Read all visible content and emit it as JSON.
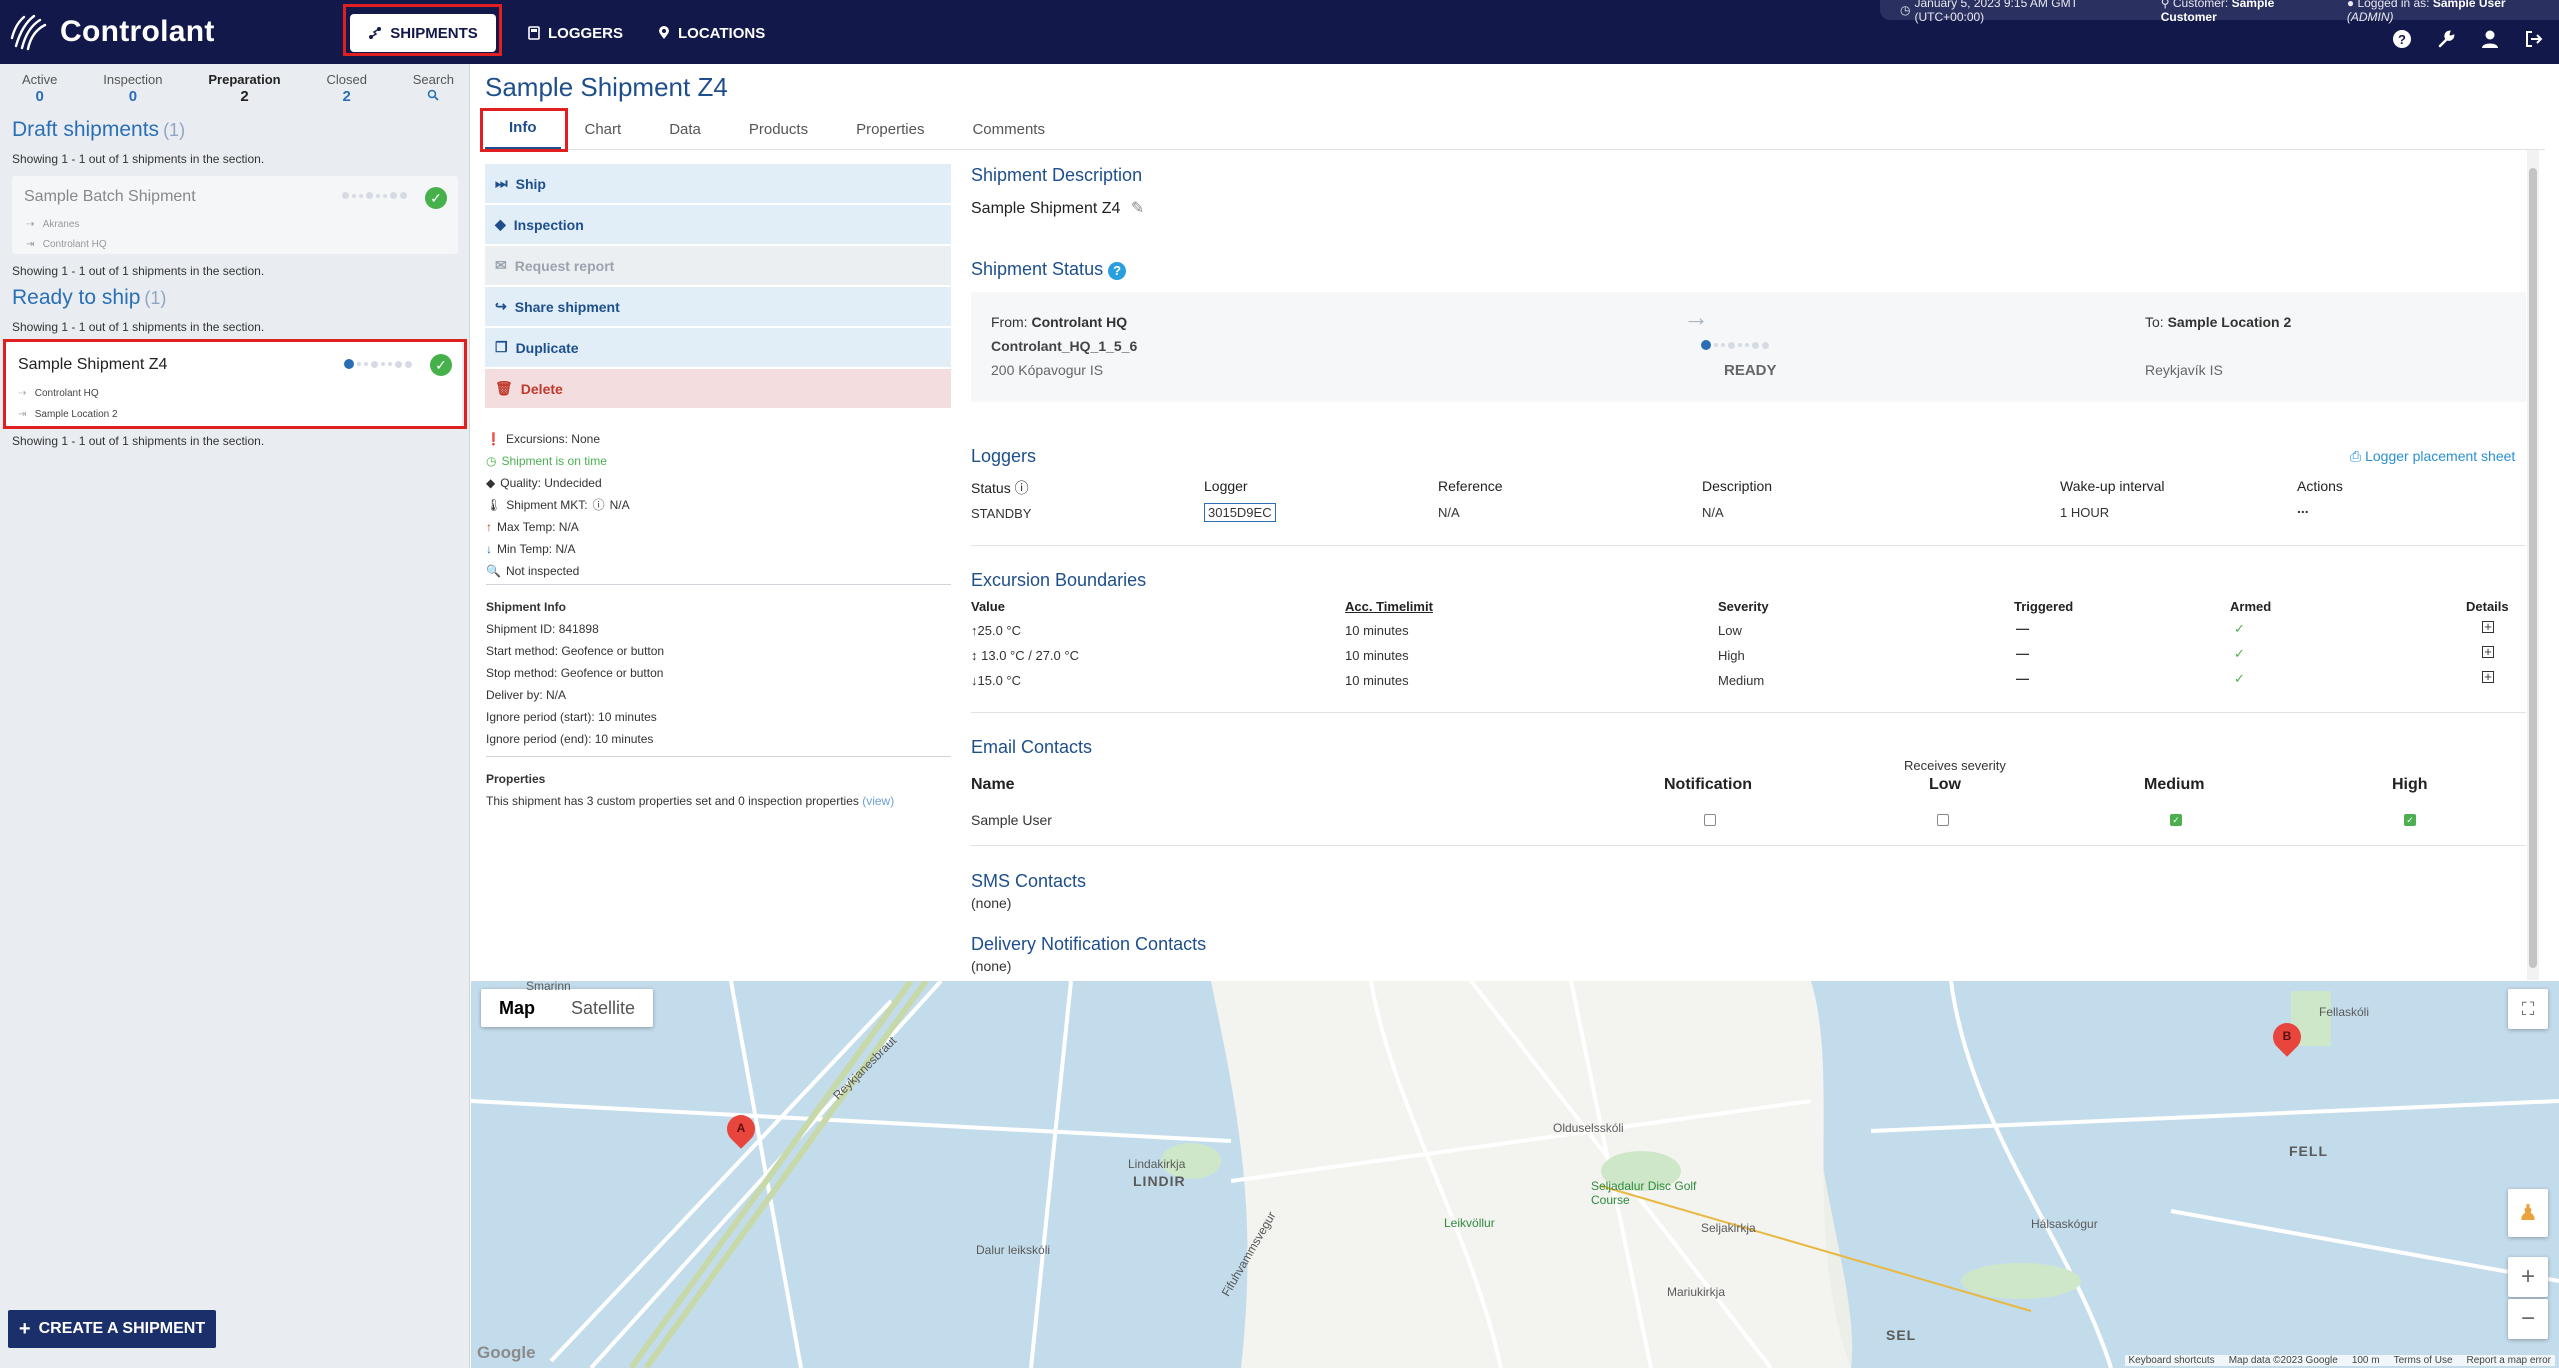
{
  "app": {
    "brand": "Controlant",
    "nav": [
      {
        "label": "SHIPMENTS",
        "icon": "route-icon"
      },
      {
        "label": "LOGGERS",
        "icon": "logger-icon"
      },
      {
        "label": "LOCATIONS",
        "icon": "location-pin-icon"
      }
    ],
    "meta": {
      "datetime": "January 5, 2023 9:15 AM GMT (UTC+00:00)",
      "customer_label": "Customer:",
      "customer": "Sample Customer",
      "logged_label": "Logged in as:",
      "user": "Sample User",
      "role": "(ADMIN)"
    },
    "top_icons": [
      "help-icon",
      "wrench-icon",
      "user-icon",
      "logout-icon"
    ]
  },
  "sidebar": {
    "counts": [
      {
        "label": "Active",
        "value": "0"
      },
      {
        "label": "Inspection",
        "value": "0"
      },
      {
        "label": "Preparation",
        "value": "2"
      },
      {
        "label": "Closed",
        "value": "2"
      },
      {
        "label": "Search",
        "value": ""
      }
    ],
    "draft": {
      "title": "Draft shipments",
      "count": "(1)",
      "showing_top": "Showing 1 - 1 out of 1 shipments in the section.",
      "card": {
        "name": "Sample Batch Shipment",
        "from": "Akranes",
        "to": "Controlant HQ"
      },
      "showing_bottom": "Showing 1 - 1 out of 1 shipments in the section."
    },
    "ready": {
      "title": "Ready to ship",
      "count": "(1)",
      "showing_top": "Showing 1 - 1 out of 1 shipments in the section.",
      "card": {
        "name": "Sample Shipment Z4",
        "from": "Controlant HQ",
        "to": "Sample Location 2"
      },
      "showing_bottom": "Showing 1 - 1 out of 1 shipments in the section."
    },
    "create_button": "CREATE A SHIPMENT"
  },
  "main": {
    "title": "Sample Shipment Z4",
    "tabs": [
      "Info",
      "Chart",
      "Data",
      "Products",
      "Properties",
      "Comments"
    ],
    "actions": [
      "Ship",
      "Inspection",
      "Request report",
      "Share shipment",
      "Duplicate",
      "Delete"
    ],
    "status_list": [
      "Excursions: None",
      "Shipment is on time",
      "Quality: Undecided",
      "Shipment MKT:",
      "N/A",
      "Max Temp: N/A",
      "Min Temp: N/A",
      "Not inspected"
    ],
    "shipment_info": {
      "heading": "Shipment Info",
      "rows": [
        "Shipment ID: 841898",
        "Start method: Geofence or button",
        "Stop method: Geofence or button",
        "Deliver by: N/A",
        "Ignore period (start): 10 minutes",
        "Ignore period (end): 10 minutes"
      ]
    },
    "properties": {
      "heading": "Properties",
      "text": "This shipment has 3 custom properties set and 0 inspection properties",
      "link": "(view)"
    },
    "description": {
      "heading": "Shipment Description",
      "value": "Sample Shipment Z4"
    },
    "status": {
      "heading": "Shipment Status",
      "from_label": "From:",
      "from_name": "Controlant HQ",
      "from_id": "Controlant_HQ_1_5_6",
      "from_addr": "200 Kópavogur IS",
      "state": "READY",
      "to_label": "To:",
      "to_name": "Sample Location 2",
      "to_addr": "Reykjavík IS"
    },
    "loggers": {
      "heading": "Loggers",
      "placement_link": "Logger placement sheet",
      "columns": [
        "Status",
        "Logger",
        "Reference",
        "Description",
        "Wake-up interval",
        "Actions"
      ],
      "row": {
        "status": "STANDBY",
        "logger": "3015D9EC",
        "reference": "N/A",
        "description": "N/A",
        "interval": "1 HOUR",
        "actions": "..."
      }
    },
    "excursions": {
      "heading": "Excursion Boundaries",
      "columns": [
        "Value",
        "Acc. Timelimit",
        "Severity",
        "Triggered",
        "Armed",
        "Details"
      ],
      "rows": [
        {
          "value": "25.0 °C",
          "dir": "up",
          "limit": "10 minutes",
          "severity": "Low",
          "triggered": "—",
          "armed": "✓"
        },
        {
          "value": "13.0 °C / 27.0 °C",
          "dir": "both",
          "limit": "10 minutes",
          "severity": "High",
          "triggered": "—",
          "armed": "✓"
        },
        {
          "value": "15.0 °C",
          "dir": "down",
          "limit": "10 minutes",
          "severity": "Medium",
          "triggered": "—",
          "armed": "✓"
        }
      ]
    },
    "email_contacts": {
      "heading": "Email Contacts",
      "receives": "Receives severity",
      "columns": [
        "Name",
        "Notification",
        "Low",
        "Medium",
        "High"
      ],
      "row": {
        "name": "Sample User",
        "notification": false,
        "low": false,
        "medium": true,
        "high": true
      }
    },
    "sms": {
      "heading": "SMS Contacts",
      "value": "(none)"
    },
    "delivery": {
      "heading": "Delivery Notification Contacts",
      "value": "(none)"
    }
  },
  "map": {
    "toggle": [
      "Map",
      "Satellite"
    ],
    "labels": [
      "LINDIR",
      "FELL",
      "SEL",
      "Lindakirkja",
      "Leikvöllur",
      "Seljakirkja",
      "Mariukirkja",
      "Olduselsskóli",
      "Seljadalur Disc Golf Course",
      "Dalur leikskóli",
      "Hálsaskógur",
      "Fellaskóli",
      "Reykjanesbraut",
      "Fifuhvammsvegur",
      "Smarinn"
    ],
    "pins": [
      "A",
      "B"
    ],
    "footer": [
      "Keyboard shortcuts",
      "Map data ©2023 Google",
      "100 m",
      "Terms of Use",
      "Report a map error"
    ],
    "google": "Google"
  }
}
